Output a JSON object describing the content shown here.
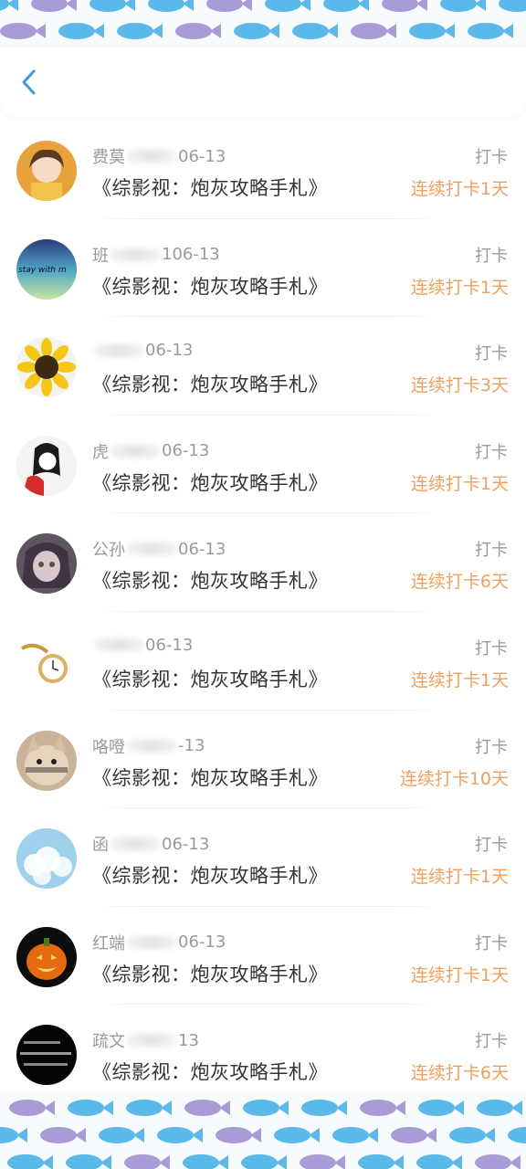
{
  "header": {
    "back_icon": "chevron-left-icon"
  },
  "colors": {
    "accent": "#f0a05e",
    "back": "#3a9be0",
    "fish_blue": "#5bb8ea",
    "fish_purple": "#a99bd6"
  },
  "items": [
    {
      "name": "费莫",
      "date": "06-13",
      "book": "《综影视：炮灰攻略手札》",
      "punch": "打卡",
      "streak": "连续打卡1天",
      "avatar": "girl-orange-avatar"
    },
    {
      "name": "班",
      "date": "106-13",
      "book": "《综影视：炮灰攻略手札》",
      "punch": "打卡",
      "streak": "连续打卡1天",
      "avatar": "stay-with-me-avatar"
    },
    {
      "name": "",
      "date": "06-13",
      "book": "《综影视：炮灰攻略手札》",
      "punch": "打卡",
      "streak": "连续打卡3天",
      "avatar": "sunflower-avatar"
    },
    {
      "name": "虎",
      "date": "06-13",
      "book": "《综影视：炮灰攻略手札》",
      "punch": "打卡",
      "streak": "连续打卡1天",
      "avatar": "girl-sketch-avatar"
    },
    {
      "name": "公孙",
      "date": "06-13",
      "book": "《综影视：炮灰攻略手札》",
      "punch": "打卡",
      "streak": "连续打卡6天",
      "avatar": "anime-girl-avatar"
    },
    {
      "name": "",
      "date": "06-13",
      "book": "《综影视：炮灰攻略手札》",
      "punch": "打卡",
      "streak": "连续打卡1天",
      "avatar": "pocket-watch-avatar"
    },
    {
      "name": "咯噔",
      "date": "-13",
      "book": "《综影视：炮灰攻略手札》",
      "punch": "打卡",
      "streak": "连续打卡10天",
      "avatar": "cat-avatar"
    },
    {
      "name": "函",
      "date": "06-13",
      "book": "《综影视：炮灰攻略手札》",
      "punch": "打卡",
      "streak": "连续打卡1天",
      "avatar": "sky-clouds-avatar"
    },
    {
      "name": "红端",
      "date": "06-13",
      "book": "《综影视：炮灰攻略手札》",
      "punch": "打卡",
      "streak": "连续打卡1天",
      "avatar": "pumpkin-avatar"
    },
    {
      "name": "疏文",
      "date": "13",
      "book": "《综影视：炮灰攻略手札》",
      "punch": "打卡",
      "streak": "连续打卡6天",
      "avatar": "black-text-avatar"
    }
  ]
}
